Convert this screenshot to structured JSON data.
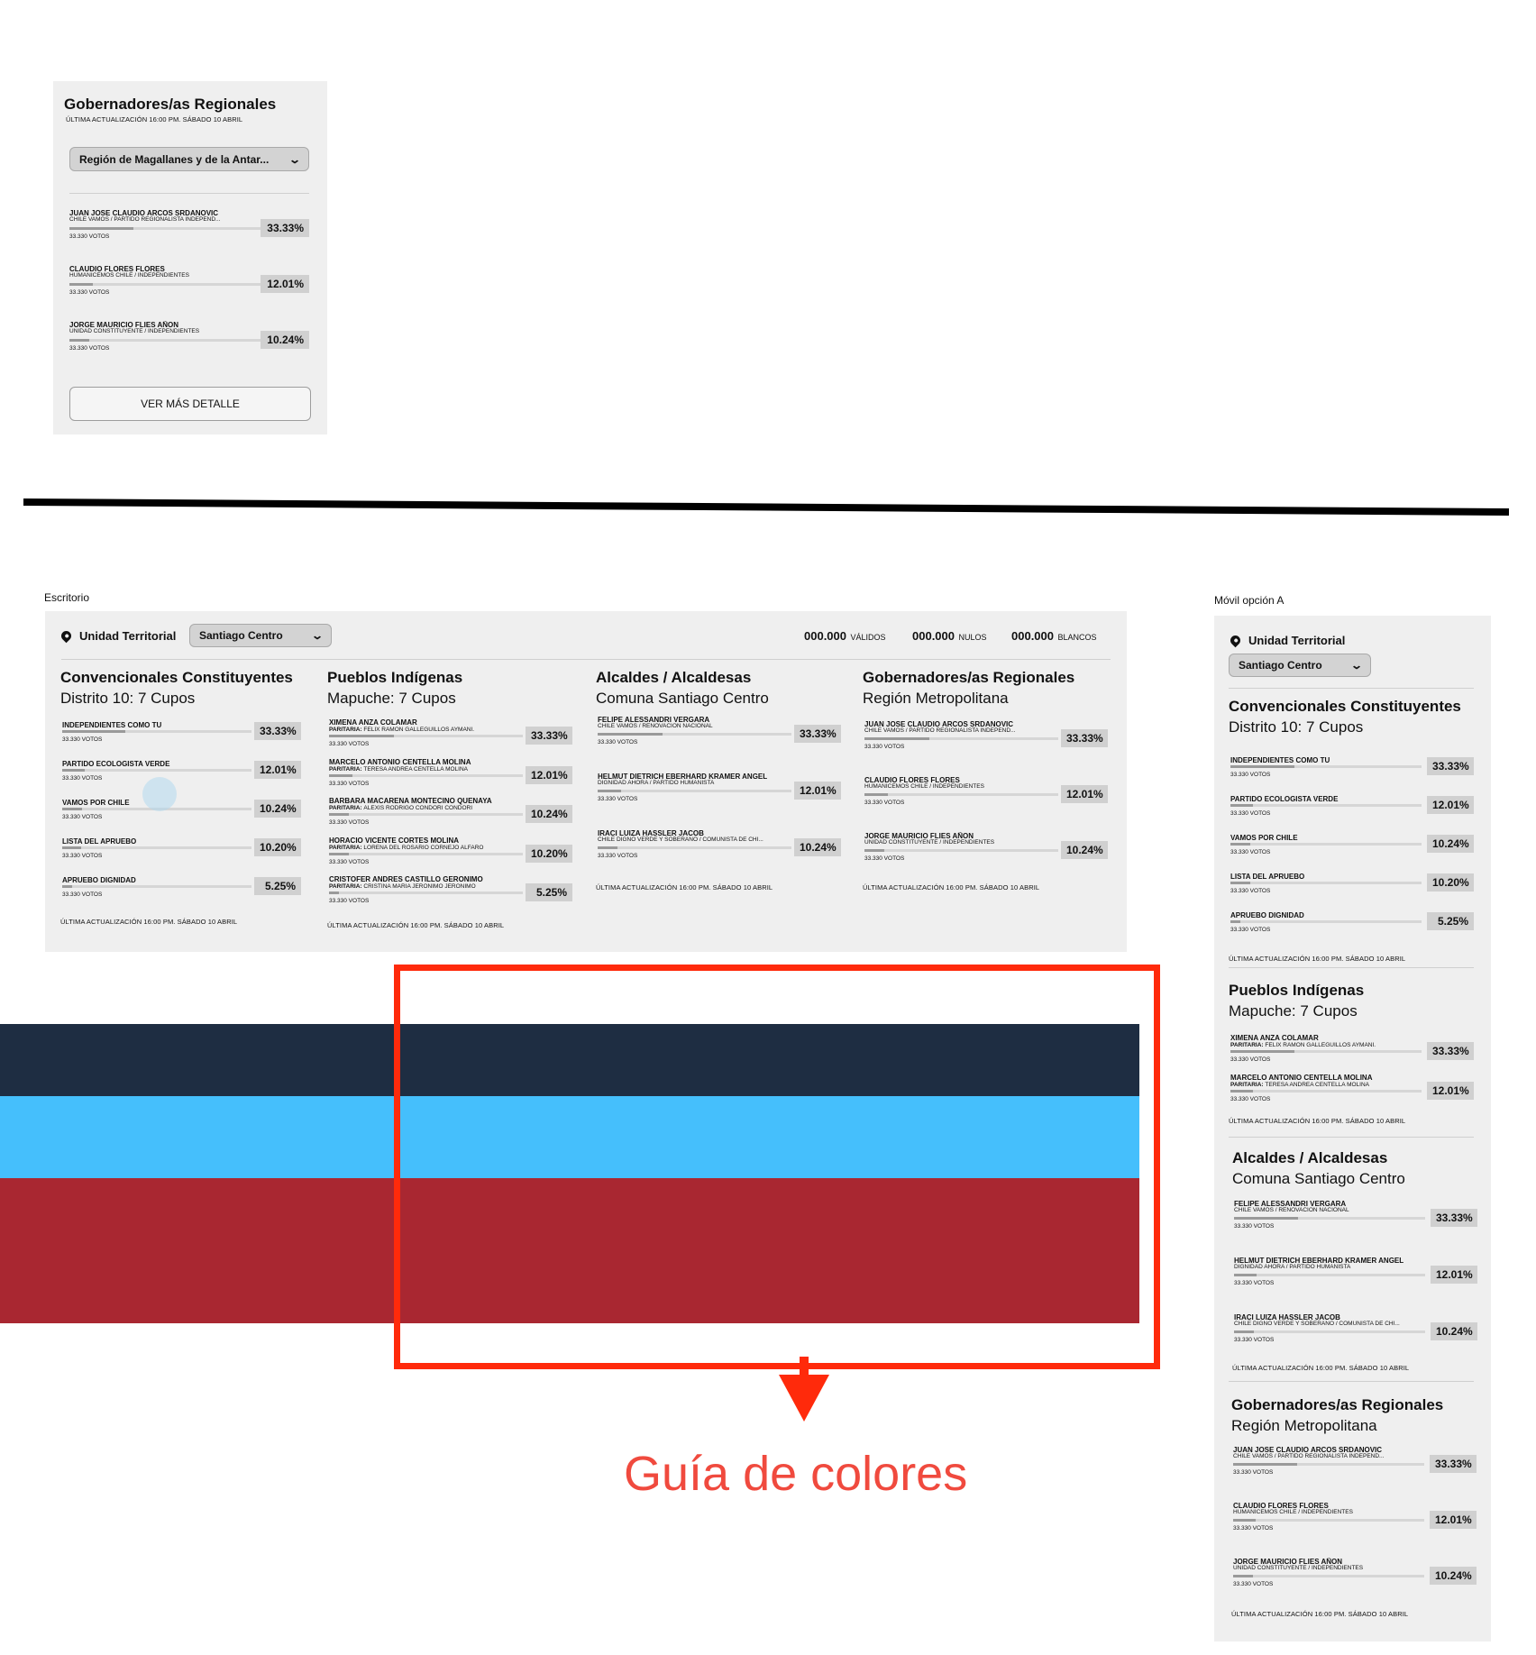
{
  "top_card": {
    "title": "Gobernadores/as Regionales",
    "updated": "ÚLTIMA ACTUALIZACIÓN 16:00 PM. SÁBADO 10 ABRIL",
    "select_value": "Región de Magallanes y de la Antar...",
    "candidates": [
      {
        "name": "JUAN JOSE CLAUDIO ARCOS SRDANOVIC",
        "party": "CHILE VAMOS / PARTIDO REGIONALISTA INDEPEND...",
        "votes": "33.330 VOTOS",
        "pct": "33.33%",
        "share": 0.3333
      },
      {
        "name": "CLAUDIO FLORES FLORES",
        "party": "HUMANICEMOS CHILE / INDEPENDIENTES",
        "votes": "33.330 VOTOS",
        "pct": "12.01%",
        "share": 0.1201
      },
      {
        "name": "JORGE MAURICIO FLIES AÑON",
        "party": "UNIDAD CONSTITUYENTE / INDEPENDIENTES",
        "votes": "33.330 VOTOS",
        "pct": "10.24%",
        "share": 0.1024
      }
    ],
    "button": "VER MÁS DETALLE"
  },
  "desktop": {
    "label": "Escritorio",
    "unit_label": "Unidad Territorial",
    "unit_value": "Santiago Centro",
    "stats": [
      {
        "value": "000.000",
        "label": "VÁLIDOS"
      },
      {
        "value": "000.000",
        "label": "NULOS"
      },
      {
        "value": "000.000",
        "label": "BLANCOS"
      }
    ],
    "updated": "ÚLTIMA ACTUALIZACIÓN 16:00 PM. SÁBADO 10 ABRIL"
  },
  "sections": {
    "conv": {
      "title": "Convencionales Constituyentes",
      "subtitle": "Distrito 10: 7 Cupos",
      "rows": [
        {
          "name": "INDEPENDIENTES COMO TU",
          "votes": "33.330 VOTOS",
          "pct": "33.33%",
          "share": 0.3333
        },
        {
          "name": "PARTIDO ECOLOGISTA VERDE",
          "votes": "33.330 VOTOS",
          "pct": "12.01%",
          "share": 0.1201
        },
        {
          "name": "VAMOS POR CHILE",
          "votes": "33.330 VOTOS",
          "pct": "10.24%",
          "share": 0.1024
        },
        {
          "name": "LISTA DEL APRUEBO",
          "votes": "33.330 VOTOS",
          "pct": "10.20%",
          "share": 0.102
        },
        {
          "name": "APRUEBO DIGNIDAD",
          "votes": "33.330 VOTOS",
          "pct": "5.25%",
          "share": 0.0525
        }
      ]
    },
    "pueblos": {
      "title": "Pueblos Indígenas",
      "subtitle": "Mapuche: 7 Cupos",
      "paritaria_label": "Paritaria:",
      "rows": [
        {
          "name": "XIMENA ANZA COLAMAR",
          "party": "FELIX RAMON GALLEGUILLOS AYMANI.",
          "votes": "33.330 VOTOS",
          "pct": "33.33%",
          "share": 0.3333
        },
        {
          "name": "MARCELO ANTONIO CENTELLA MOLINA",
          "party": "TERESA ANDREA CENTELLA MOLINA",
          "votes": "33.330 VOTOS",
          "pct": "12.01%",
          "share": 0.1201
        },
        {
          "name": "BARBARA MACARENA MONTECINO QUENAYA",
          "party": "ALEXIS RODRIGO CONDORI CONDORI",
          "votes": "33.330 VOTOS",
          "pct": "10.24%",
          "share": 0.1024
        },
        {
          "name": "HORACIO VICENTE CORTES MOLINA",
          "party": "LORENA DEL ROSARIO CORNEJO ALFARO",
          "votes": "33.330 VOTOS",
          "pct": "10.20%",
          "share": 0.102
        },
        {
          "name": "CRISTOFER ANDRES CASTILLO GERONIMO",
          "party": "CRISTINA MARIA JERONIMO JERONIMO",
          "votes": "33.330 VOTOS",
          "pct": "5.25%",
          "share": 0.0525
        }
      ]
    },
    "alcaldes": {
      "title": "Alcaldes / Alcaldesas",
      "subtitle": "Comuna Santiago Centro",
      "rows": [
        {
          "name": "FELIPE ALESSANDRI VERGARA",
          "party": "CHILE VAMOS / RENOVACIÓN NACIONAL",
          "votes": "33.330 VOTOS",
          "pct": "33.33%",
          "share": 0.3333
        },
        {
          "name": "HELMUT DIETRICH EBERHARD KRAMER ANGEL",
          "party": "DIGNIDAD AHORA / PARTIDO HUMANISTA",
          "votes": "33.330 VOTOS",
          "pct": "12.01%",
          "share": 0.1201
        },
        {
          "name": "IRACI LUIZA HASSLER JACOB",
          "party": "CHILE DIGNO VERDE Y SOBERANO / COMUNISTA DE CHI...",
          "votes": "33.330 VOTOS",
          "pct": "10.24%",
          "share": 0.1024
        }
      ]
    },
    "gob": {
      "title": "Gobernadores/as Regionales",
      "subtitle": "Región Metropolitana",
      "rows": [
        {
          "name": "JUAN JOSE CLAUDIO ARCOS SRDANOVIC",
          "party": "CHILE VAMOS / PARTIDO REGIONALISTA INDEPEND...",
          "votes": "33.330 VOTOS",
          "pct": "33.33%",
          "share": 0.3333
        },
        {
          "name": "CLAUDIO FLORES FLORES",
          "party": "HUMANICEMOS CHILE / INDEPENDIENTES",
          "votes": "33.330 VOTOS",
          "pct": "12.01%",
          "share": 0.1201
        },
        {
          "name": "JORGE MAURICIO FLIES AÑON",
          "party": "UNIDAD CONSTITUYENTE / INDEPENDIENTES",
          "votes": "33.330 VOTOS",
          "pct": "10.24%",
          "share": 0.1024
        }
      ]
    }
  },
  "mobile": {
    "label": "Móvil opción A",
    "unit_label": "Unidad Territorial",
    "unit_value": "Santiago Centro"
  },
  "guide": {
    "label": "Guía de colores",
    "colors": [
      "#1e2d42",
      "#45bffc",
      "#a92731"
    ],
    "frame_color": "#ff2a0b"
  }
}
